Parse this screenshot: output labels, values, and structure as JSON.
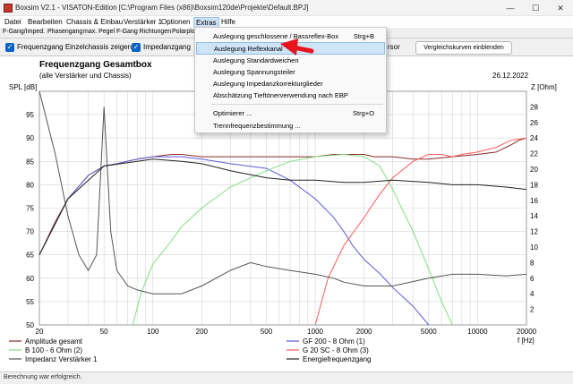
{
  "window": {
    "title": "Boxsim V2.1 - VISATON-Edition [C:\\Program Files (x86)\\Boxsim120de\\Projekte\\Default.BPJ]",
    "min_symbol": "—",
    "max_symbol": "☐",
    "close_symbol": "✕"
  },
  "menu": [
    {
      "label": "Datei"
    },
    {
      "label": "Bearbeiten"
    },
    {
      "label": "Chassis & Einbau"
    },
    {
      "label": "Verstärker 1"
    },
    {
      "label": "Optionen"
    },
    {
      "label": "Extras"
    },
    {
      "label": "Hilfe"
    }
  ],
  "tabs": [
    {
      "label": "F-Gang/Imped."
    },
    {
      "label": "Phasengang"
    },
    {
      "label": "max. Pegel"
    },
    {
      "label": "F-Gang Richtungen"
    },
    {
      "label": "Polarplot"
    }
  ],
  "toolbar": {
    "check1_label": "Frequenzgang Einzelchassis zeigen",
    "check2_label": "Impedanzgang",
    "cursor_label": "rsor",
    "compare_button": "Vergleichskurven einblenden",
    "check_mark": "✓"
  },
  "extras_menu": {
    "items": [
      {
        "label": "Auslegung geschlossene / Bassreflex-Box",
        "shortcut": "Strg+B"
      },
      {
        "label": "Auslegung Reflexkanal",
        "shortcut": ""
      },
      {
        "label": "Auslegung Standardweichen",
        "shortcut": ""
      },
      {
        "label": "Auslegung Spannungsteiler",
        "shortcut": ""
      },
      {
        "label": "Auslegung Impedanzkorrekturglieder",
        "shortcut": ""
      },
      {
        "label": "Abschätzung Tieftönerverwendung nach EBP",
        "shortcut": ""
      },
      {
        "label": "Optimierer ...",
        "shortcut": "Strg+O"
      },
      {
        "label": "Trennfrequenzbestimmung ...",
        "shortcut": ""
      }
    ]
  },
  "status": {
    "text": "Berechnung war erfolgreich."
  },
  "colors": {
    "amplitude": "#8b2a2a",
    "b100": "#7ee07e",
    "impedance": "#555555",
    "gf200": "#5a5ad8",
    "g20sc": "#ff5a5a",
    "energy": "#222222",
    "arrow": "#e8141e"
  },
  "chart_data": {
    "type": "line",
    "title": "Frequenzgang Gesamtbox",
    "subtitle": "(alle Verstärker und Chassis)",
    "date": "26.12.2022",
    "ylabel": "SPL [dB]",
    "y2label": "Z [Ohm]",
    "xlabel": "f [Hz]",
    "xscale": "log",
    "xlim": [
      20,
      20000
    ],
    "ylim": [
      50,
      100
    ],
    "y2lim": [
      0,
      30
    ],
    "x_ticks": [
      20,
      50,
      100,
      200,
      500,
      1000,
      2000,
      5000,
      10000,
      20000
    ],
    "x_tick_labels": [
      "20",
      "50",
      "100",
      "200",
      "500",
      "1000",
      "2000",
      "5000",
      "10000",
      "20000"
    ],
    "y_ticks": [
      50,
      55,
      60,
      65,
      70,
      75,
      80,
      85,
      90,
      95,
      100
    ],
    "y2_ticks": [
      2,
      4,
      6,
      8,
      10,
      12,
      14,
      16,
      18,
      20,
      22,
      24,
      26,
      28
    ],
    "grid": true,
    "legend_position": "bottom",
    "series": [
      {
        "name": "Amplitude gesamt",
        "axis": "left",
        "x": [
          20,
          25,
          30,
          40,
          50,
          60,
          80,
          100,
          130,
          150,
          200,
          300,
          500,
          700,
          1000,
          1300,
          1500,
          1700,
          2000,
          2300,
          3000,
          4000,
          5000,
          7000,
          10000,
          13000,
          16000,
          18000,
          20000
        ],
        "y": [
          65,
          72,
          77,
          82,
          84,
          84.5,
          85.5,
          86,
          86.5,
          86.5,
          86,
          86,
          86,
          86,
          86,
          86.5,
          86.5,
          86.5,
          86.5,
          86,
          86,
          85.5,
          85.5,
          86,
          86.5,
          87,
          88.5,
          89.5,
          90
        ]
      },
      {
        "name": "GF 200 - 8 Ohm (1)",
        "axis": "left",
        "x": [
          20,
          30,
          40,
          50,
          60,
          80,
          100,
          150,
          200,
          300,
          500,
          700,
          1000,
          1300,
          1500,
          1700,
          2000,
          2500,
          3000,
          4000,
          5000
        ],
        "y": [
          65,
          77,
          82,
          84,
          84.5,
          85.5,
          86,
          86,
          85.5,
          84.5,
          83.5,
          81,
          77,
          73,
          70,
          67,
          64,
          61,
          58,
          54,
          50
        ]
      },
      {
        "name": "B 100 - 6 Ohm (2)",
        "axis": "left",
        "x": [
          75,
          85,
          100,
          130,
          150,
          200,
          300,
          500,
          700,
          1000,
          1500,
          2000,
          2500,
          3000,
          4000,
          5000,
          6000,
          7000
        ],
        "y": [
          50,
          57,
          63,
          68,
          71,
          75,
          79.5,
          83,
          85,
          86,
          86.5,
          86,
          84,
          79,
          70,
          62,
          55,
          50
        ]
      },
      {
        "name": "G 20 SC - 8 Ohm (3)",
        "axis": "left",
        "x": [
          1000,
          1200,
          1500,
          2000,
          2500,
          3000,
          4000,
          5000,
          6000,
          7000,
          8000,
          10000,
          13000,
          16000,
          20000
        ],
        "y": [
          50,
          60,
          67,
          73,
          78,
          81.5,
          85,
          86.5,
          86.5,
          86,
          86.5,
          87,
          88,
          89.5,
          90
        ]
      },
      {
        "name": "Impedanz Verstärker 1",
        "axis": "right",
        "x": [
          20,
          25,
          30,
          35,
          40,
          45,
          50,
          55,
          60,
          70,
          80,
          100,
          150,
          200,
          300,
          400,
          500,
          700,
          1000,
          1300,
          1500,
          2000,
          2500,
          3000,
          5000,
          7000,
          10000,
          15000,
          20000
        ],
        "y": [
          30,
          22,
          14,
          9,
          7,
          9,
          28,
          12,
          7,
          5,
          4.5,
          4,
          4,
          5,
          7,
          8,
          7.5,
          7,
          6.5,
          6,
          5.5,
          5,
          5,
          5,
          6,
          6.5,
          6.5,
          6.3,
          6.5
        ]
      },
      {
        "name": "Energiefrequenzgang",
        "axis": "left",
        "x": [
          20,
          30,
          50,
          100,
          150,
          200,
          300,
          500,
          700,
          1000,
          1500,
          2000,
          3000,
          5000,
          7000,
          10000,
          15000,
          20000
        ],
        "y": [
          65,
          77,
          84,
          85.5,
          85,
          84.5,
          83,
          81.5,
          81,
          81,
          80.5,
          80.5,
          81,
          80.5,
          80,
          80,
          79.5,
          79
        ]
      }
    ]
  }
}
